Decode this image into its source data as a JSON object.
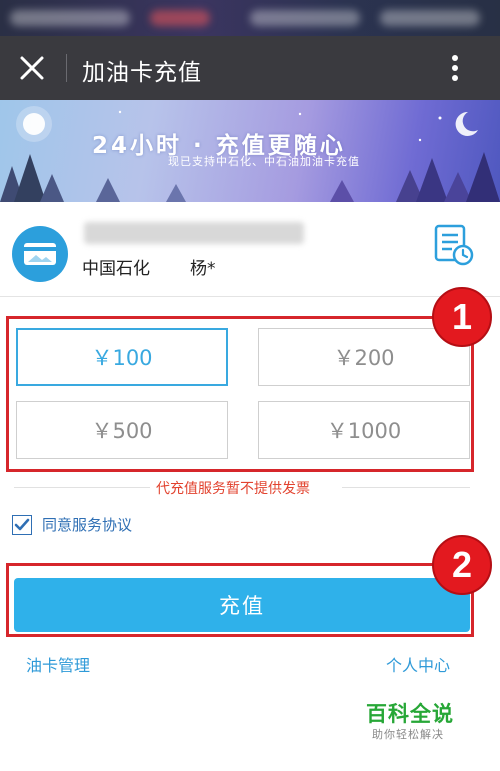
{
  "colors": {
    "accent": "#2fb1ea",
    "selected": "#39a9e0",
    "annotation": "#e3191f",
    "notice": "#e2432f",
    "link": "#2f9ad8"
  },
  "header": {
    "title": "加油卡充值",
    "close_icon": "close-icon",
    "more_icon": "more-vertical-icon"
  },
  "banner": {
    "headline": "24小时 · 充值更随心",
    "subtitle": "现已支持中石化、中石油加油卡充值"
  },
  "card": {
    "company": "中国石化",
    "owner": "杨*",
    "icon": "card-icon",
    "bill_icon": "bill-history-icon"
  },
  "amounts": [
    {
      "label": "￥100",
      "selected": true
    },
    {
      "label": "￥200",
      "selected": false
    },
    {
      "label": "￥500",
      "selected": false
    },
    {
      "label": "￥1000",
      "selected": false
    }
  ],
  "notice": "代充值服务暂不提供发票",
  "agreement": {
    "label": "同意服务协议",
    "checked": true
  },
  "submit_label": "充值",
  "links": {
    "left": "油卡管理",
    "right": "个人中心"
  },
  "annotations": [
    "1",
    "2"
  ],
  "watermark": {
    "title": "百科全说",
    "subtitle": "助你轻松解决"
  }
}
